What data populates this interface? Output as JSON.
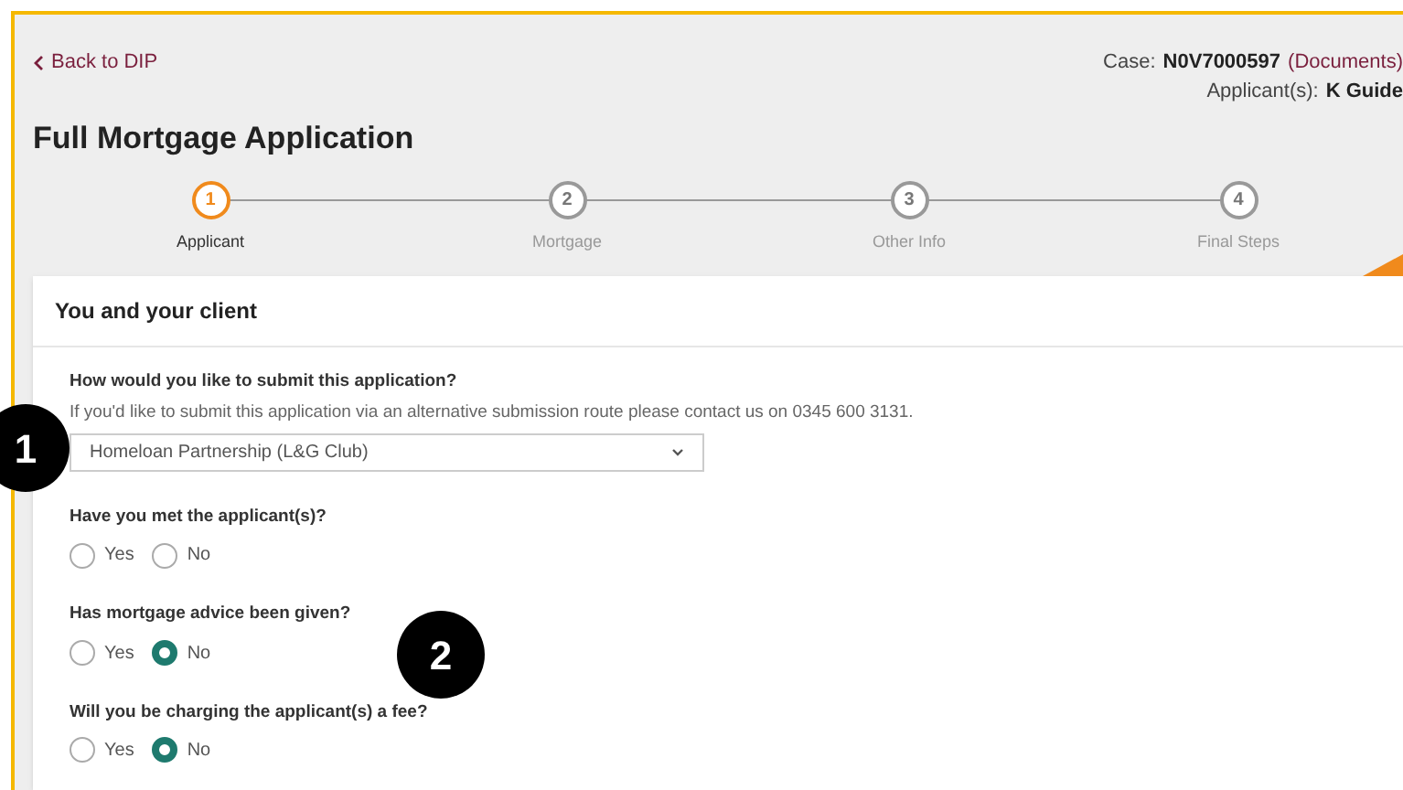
{
  "header": {
    "back_link": "Back to DIP",
    "case_label": "Case:",
    "case_number": "N0V7000597",
    "documents_link": "(Documents)",
    "applicants_label": "Applicant(s):",
    "applicants_value": "K Guide"
  },
  "title": "Full Mortgage Application",
  "steps": [
    {
      "number": "1",
      "label": "Applicant",
      "selected": true
    },
    {
      "number": "2",
      "label": "Mortgage",
      "selected": false
    },
    {
      "number": "3",
      "label": "Other Info",
      "selected": false
    },
    {
      "number": "4",
      "label": "Final Steps",
      "selected": false
    }
  ],
  "section": {
    "title": "You and your client",
    "submission": {
      "question": "How would you like to submit this application?",
      "hint": "If you'd like to submit this application via an alternative submission route please contact us on 0345 600 3131.",
      "value": "Homeloan Partnership (L&G Club)"
    },
    "questions": [
      {
        "question": "Have you met the applicant(s)?",
        "options": [
          {
            "label": "Yes",
            "selected": false
          },
          {
            "label": "No",
            "selected": false
          }
        ]
      },
      {
        "question": "Has mortgage advice been given?",
        "options": [
          {
            "label": "Yes",
            "selected": false
          },
          {
            "label": "No",
            "selected": true
          }
        ]
      },
      {
        "question": "Will you be charging the applicant(s) a fee?",
        "options": [
          {
            "label": "Yes",
            "selected": false
          },
          {
            "label": "No",
            "selected": true
          }
        ]
      }
    ]
  },
  "callouts": [
    "1",
    "2"
  ]
}
